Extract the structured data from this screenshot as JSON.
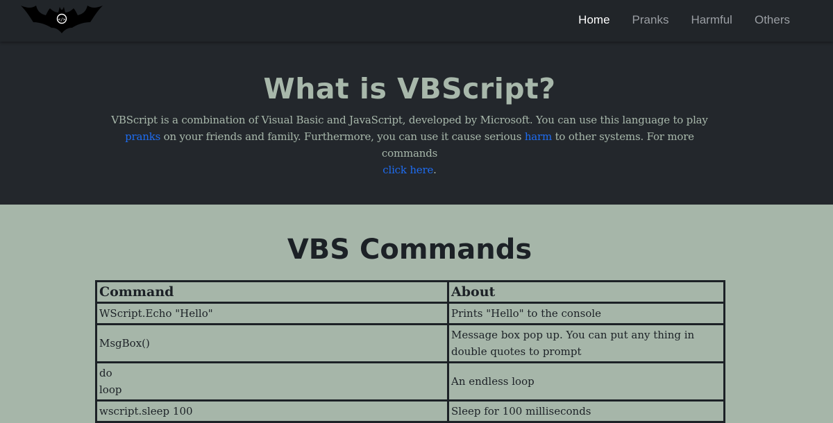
{
  "nav": {
    "links": [
      {
        "label": "Home",
        "active": true
      },
      {
        "label": "Pranks",
        "active": false
      },
      {
        "label": "Harmful",
        "active": false
      },
      {
        "label": "Others",
        "active": false
      }
    ]
  },
  "hero": {
    "title": "What is VBScript?",
    "desc_part1": "VBScript is a combination of Visual Basic and JavaScript, developed by Microsoft. You can use this language to play ",
    "link_pranks": "pranks",
    "desc_part2": " on your friends and family. Furthermore, you can use it cause serious ",
    "link_harm": "harm",
    "desc_part3": " to other systems. For more commands ",
    "link_click": "click here",
    "desc_end": "."
  },
  "commands": {
    "title": "VBS Commands",
    "headers": [
      "Command",
      "About"
    ],
    "rows": [
      {
        "command": "WScript.Echo \"Hello\"",
        "about": "Prints \"Hello\" to the console"
      },
      {
        "command": "MsgBox()",
        "about": "Message box pop up. You can put any thing in double quotes to prompt"
      },
      {
        "command_lines": [
          "do",
          "loop"
        ],
        "about": "An endless loop"
      },
      {
        "command": "wscript.sleep 100",
        "about": "Sleep for 100 milliseconds"
      }
    ]
  },
  "colors": {
    "navbar_bg": "#212529",
    "hero_bg": "#23272c",
    "page_bg": "#a6b6a9",
    "link": "#1e6cf0"
  }
}
